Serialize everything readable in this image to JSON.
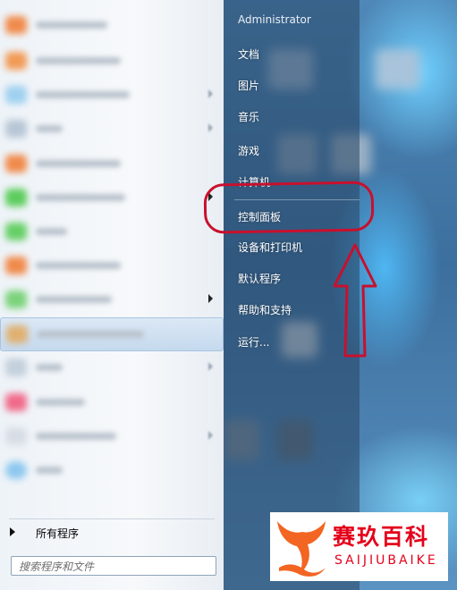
{
  "start_menu": {
    "user_name": "Administrator",
    "places": [
      {
        "id": "documents",
        "label": "文档"
      },
      {
        "id": "pictures",
        "label": "图片"
      },
      {
        "id": "music",
        "label": "音乐"
      },
      {
        "id": "games",
        "label": "游戏"
      },
      {
        "id": "computer",
        "label": "计算机"
      },
      {
        "id": "control_panel",
        "label": "控制面板"
      },
      {
        "id": "devices_printers",
        "label": "设备和打印机"
      },
      {
        "id": "default_programs",
        "label": "默认程序"
      },
      {
        "id": "help_support",
        "label": "帮助和支持"
      },
      {
        "id": "run",
        "label": "运行..."
      }
    ],
    "all_programs_label": "所有程序",
    "search_placeholder": "搜索程序和文件"
  },
  "annotation": {
    "highlighted_item": "控制面板",
    "color": "#c8102e"
  },
  "watermark": {
    "brand_cn": "赛玖百科",
    "brand_en": "SAIJIUBAIKE",
    "color": "#e4001b"
  },
  "icons": [
    "triangle-right-icon",
    "up-arrow-annotation",
    "whale-tail-logo-icon"
  ]
}
